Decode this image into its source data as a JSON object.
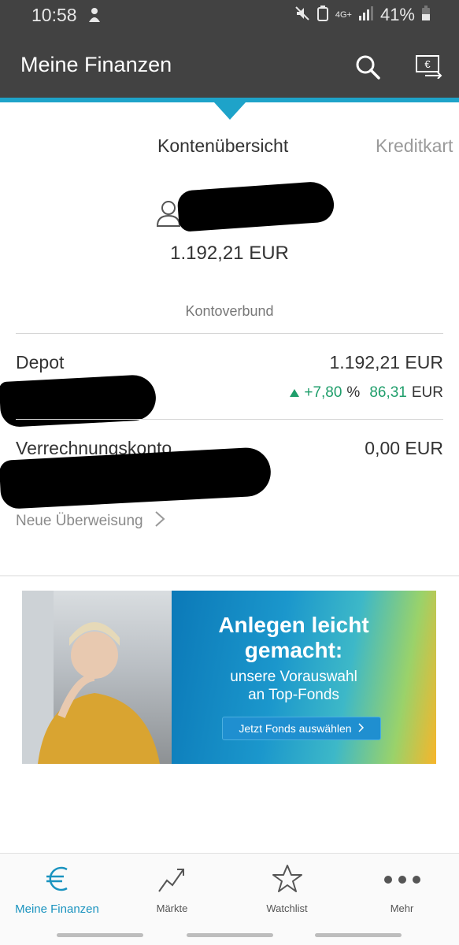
{
  "status_bar": {
    "time": "10:58",
    "battery": "41%",
    "network": "4G+"
  },
  "app_bar": {
    "title": "Meine Finanzen"
  },
  "tabs": {
    "active": "Kontenübersicht",
    "next": "Kreditkart"
  },
  "overview": {
    "total_balance": "1.192,21 EUR",
    "group_title": "Kontoverbund"
  },
  "accounts": [
    {
      "name": "Depot",
      "balance": "1.192,21 EUR",
      "perf_percent": "+7,80",
      "perf_percent_unit": "%",
      "perf_amount": "86,31",
      "perf_amount_unit": "EUR"
    },
    {
      "name": "Verrechnungskonto",
      "balance": "0,00 EUR"
    }
  ],
  "transfer_link": "Neue Überweisung",
  "banner": {
    "headline_1": "Anlegen leicht",
    "headline_2": "gemacht:",
    "sub_1": "unsere Vorauswahl",
    "sub_2": "an Top-Fonds",
    "cta": "Jetzt Fonds auswählen"
  },
  "bottom_nav": [
    {
      "label": "Meine Finanzen",
      "icon": "euro-icon",
      "active": true
    },
    {
      "label": "Märkte",
      "icon": "chart-trend-icon",
      "active": false
    },
    {
      "label": "Watchlist",
      "icon": "star-icon",
      "active": false
    },
    {
      "label": "Mehr",
      "icon": "more-dots-icon",
      "active": false
    }
  ],
  "colors": {
    "app_bar": "#424242",
    "accent": "#1ea3c9",
    "positive": "#1f9e6b",
    "nav_active": "#1a93bf"
  }
}
